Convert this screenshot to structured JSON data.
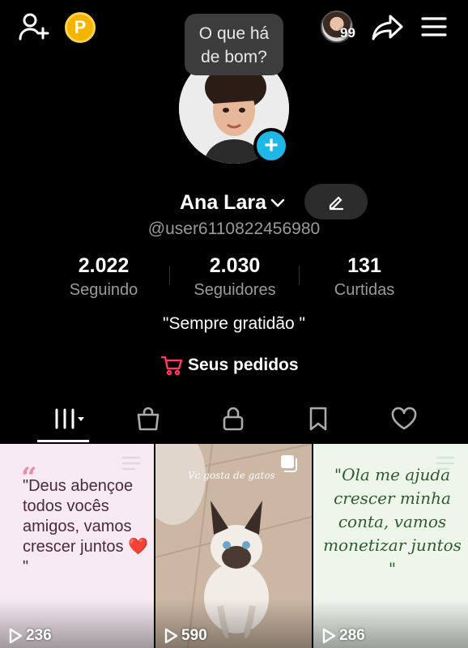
{
  "header": {
    "coin_label": "P",
    "visitor_count": "99"
  },
  "tooltip": {
    "line1": "O que há",
    "line2": "de bom?"
  },
  "profile": {
    "name": "Ana Lara",
    "username": "@user6110822456980",
    "bio": "\"Sempre gratidão \"",
    "orders_label": "Seus pedidos"
  },
  "stats": [
    {
      "value": "2.022",
      "label": "Seguindo"
    },
    {
      "value": "2.030",
      "label": "Seguidores"
    },
    {
      "value": "131",
      "label": "Curtidas"
    }
  ],
  "tabs": [
    "videos-grid",
    "shop",
    "private",
    "saved",
    "liked"
  ],
  "videos": [
    {
      "text": "\"Deus abençoe todos vocês amigos, vamos crescer juntos ❤️ \"",
      "plays": "236"
    },
    {
      "caption": "Vc gosta de gatos",
      "plays": "590"
    },
    {
      "text": "\"Ola me ajuda crescer minha conta, vamos monetizar juntos \"",
      "plays": "286"
    }
  ],
  "colors": {
    "background": "#000000",
    "accent_blue": "#1fb7e8",
    "coin": "#f5b400",
    "orders_icon": "#ff3b5c"
  }
}
